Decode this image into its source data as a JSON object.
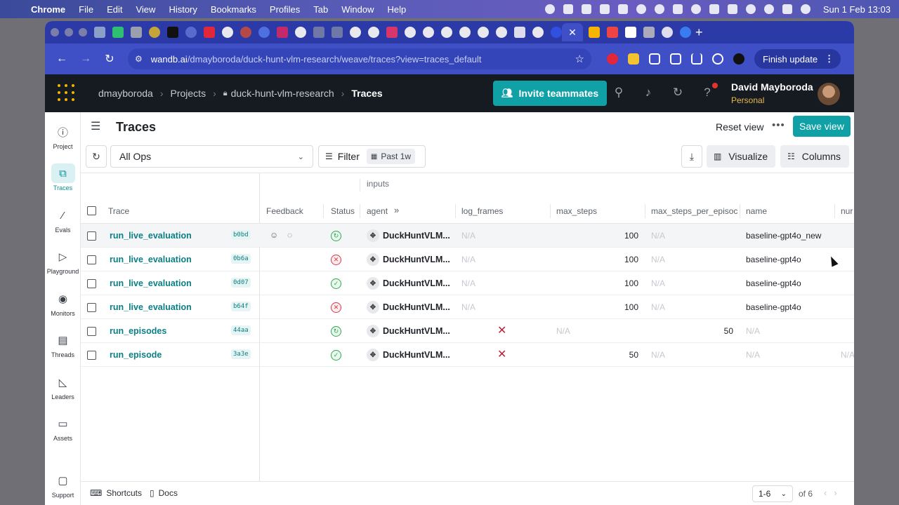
{
  "menubar": {
    "app": "Chrome",
    "menus": [
      "File",
      "Edit",
      "View",
      "History",
      "Bookmarks",
      "Profiles",
      "Tab",
      "Window",
      "Help"
    ],
    "clock": "Sun 1 Feb  13:03"
  },
  "browser": {
    "url_domain": "wandb.ai",
    "url_path": "/dmayboroda/duck-hunt-vlm-research/weave/traces?view=traces_default",
    "finish_update": "Finish update"
  },
  "header": {
    "breadcrumbs": [
      "dmayboroda",
      "Projects",
      "duck-hunt-vlm-research",
      "Traces"
    ],
    "invite": "Invite teammates",
    "user_name": "David Mayboroda",
    "workspace": "Personal"
  },
  "nav": [
    {
      "label": "Project",
      "icon": "info-icon"
    },
    {
      "label": "Traces",
      "icon": "traces-icon"
    },
    {
      "label": "Evals",
      "icon": "evals-icon"
    },
    {
      "label": "Playground",
      "icon": "playground-icon"
    },
    {
      "label": "Monitors",
      "icon": "monitors-icon"
    },
    {
      "label": "Threads",
      "icon": "threads-icon"
    },
    {
      "label": "Leaders",
      "icon": "leaders-icon"
    },
    {
      "label": "Assets",
      "icon": "assets-icon"
    },
    {
      "label": "Support",
      "icon": "support-icon"
    }
  ],
  "page": {
    "title": "Traces",
    "reset_view": "Reset view",
    "save_view": "Save view"
  },
  "filters": {
    "op_select": "All Ops",
    "filter": "Filter",
    "date_chip": "Past 1w",
    "visualize": "Visualize",
    "columns": "Columns"
  },
  "table": {
    "group_header": "inputs",
    "headers": {
      "trace": "Trace",
      "feedback": "Feedback",
      "status": "Status",
      "agent": "agent",
      "log_frames": "log_frames",
      "max_steps": "max_steps",
      "max_steps_per_episode": "max_steps_per_episoc",
      "name": "name",
      "num": "nur"
    },
    "na": "N/A",
    "rows": [
      {
        "op": "run_live_evaluation",
        "id": "b0bd",
        "status": "running",
        "agent": "DuckHuntVLM...",
        "max_steps": "100",
        "name": "baseline-gpt4o_new"
      },
      {
        "op": "run_live_evaluation",
        "id": "0b6a",
        "status": "error",
        "agent": "DuckHuntVLM...",
        "max_steps": "100",
        "name": "baseline-gpt4o"
      },
      {
        "op": "run_live_evaluation",
        "id": "0d07",
        "status": "success",
        "agent": "DuckHuntVLM...",
        "max_steps": "100",
        "name": "baseline-gpt4o"
      },
      {
        "op": "run_live_evaluation",
        "id": "b64f",
        "status": "error",
        "agent": "DuckHuntVLM...",
        "max_steps": "100",
        "name": "baseline-gpt4o"
      },
      {
        "op": "run_episodes",
        "id": "44aa",
        "status": "running",
        "agent": "DuckHuntVLM...",
        "max_steps_per_episode": "50"
      },
      {
        "op": "run_episode",
        "id": "3a3e",
        "status": "success",
        "agent": "DuckHuntVLM...",
        "max_steps": "50"
      }
    ]
  },
  "footer": {
    "shortcuts": "Shortcuts",
    "docs": "Docs",
    "range": "1-6",
    "of": "of 6"
  },
  "colors": {
    "accent": "#10a1a6",
    "browser": "#3f4fc6",
    "header_bg": "#161b22",
    "error": "#d93848",
    "success": "#2fa84f"
  }
}
